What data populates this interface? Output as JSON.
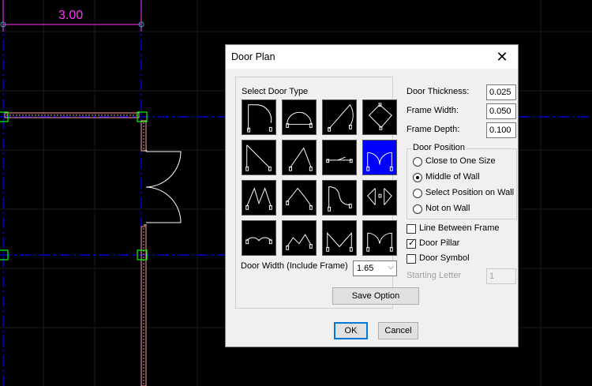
{
  "cad": {
    "dimension_text": "3.00",
    "colors": {
      "grid": "#1a1a1a",
      "centerline": "#0000ff",
      "wall": "#ff9b9b",
      "dimension": "#ff33ff",
      "node": "#00ff00",
      "door": "#ffffff"
    }
  },
  "dialog": {
    "title": "Door Plan",
    "close_icon": "close-icon",
    "door_type_group_label": "Select Door Type",
    "door_types_selected_index": 7,
    "door_width_label": "Door Width (Include Frame)",
    "door_width_value": "1.65",
    "door_thickness_label": "Door Thickness:",
    "door_thickness_value": "0.025",
    "frame_width_label": "Frame Width:",
    "frame_width_value": "0.050",
    "frame_depth_label": "Frame Depth:",
    "frame_depth_value": "0.100",
    "door_position_group_label": "Door Position",
    "positions": [
      {
        "label": "Close to One Size",
        "checked": false
      },
      {
        "label": "Middle of Wall",
        "checked": true
      },
      {
        "label": "Select Position on Wall",
        "checked": false
      },
      {
        "label": "Not on Wall",
        "checked": false
      }
    ],
    "checkboxes": [
      {
        "label": "Line Between Frame",
        "checked": false
      },
      {
        "label": "Door Pillar",
        "checked": true
      },
      {
        "label": "Door Symbol",
        "checked": false
      }
    ],
    "starting_letter_label": "Starting Letter",
    "starting_letter_value": "1",
    "save_option_label": "Save Option",
    "ok_label": "OK",
    "cancel_label": "Cancel"
  }
}
